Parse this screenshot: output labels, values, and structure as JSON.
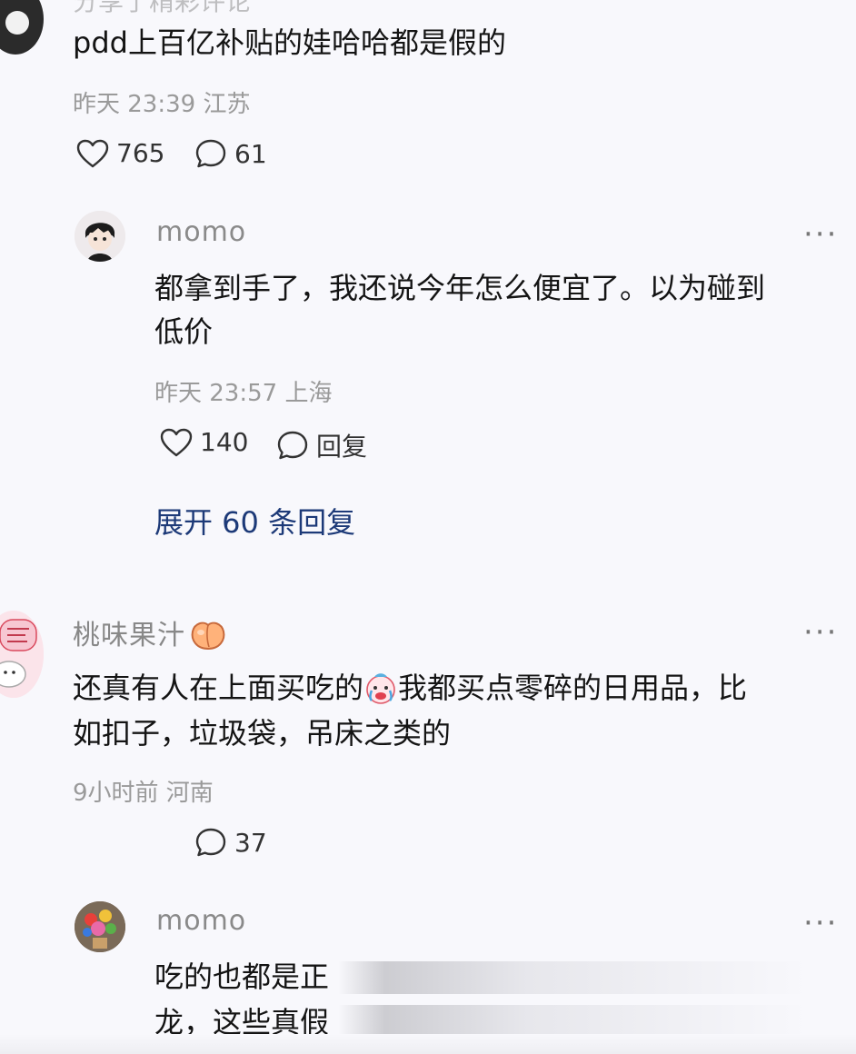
{
  "comment1": {
    "header_partial": "分享了精彩评论",
    "text": "pdd上百亿补贴的娃哈哈都是假的",
    "meta": "昨天 23:39 江苏",
    "likes": "765",
    "replies": "61"
  },
  "reply1": {
    "name": "momo",
    "text_line1": "都拿到手了，我还说今年怎么便宜了。以为碰到",
    "text_line2": "低价",
    "meta": "昨天 23:57 上海",
    "likes": "140",
    "reply_label": "回复",
    "more": "···"
  },
  "expand_label": "展开 60 条回复",
  "comment2": {
    "name": "桃味果汁",
    "emoji": "peach-emoji",
    "text_line1_a": "还真有人在上面买吃的",
    "text_line1_b": "我都买点零碎的日用品，比",
    "text_line2": "如扣子，垃圾袋，吊床之类的",
    "meta": "9小时前 河南",
    "replies": "37",
    "more": "···",
    "inline_emoji": "crying-face-emoji"
  },
  "reply2": {
    "name": "momo",
    "text_line1": "吃的也都是正",
    "text_line2": "龙，这些真假",
    "more": "···"
  },
  "colors": {
    "background": "#f8f8fc",
    "link": "#1d3a78",
    "meta": "#9a9a9a"
  }
}
